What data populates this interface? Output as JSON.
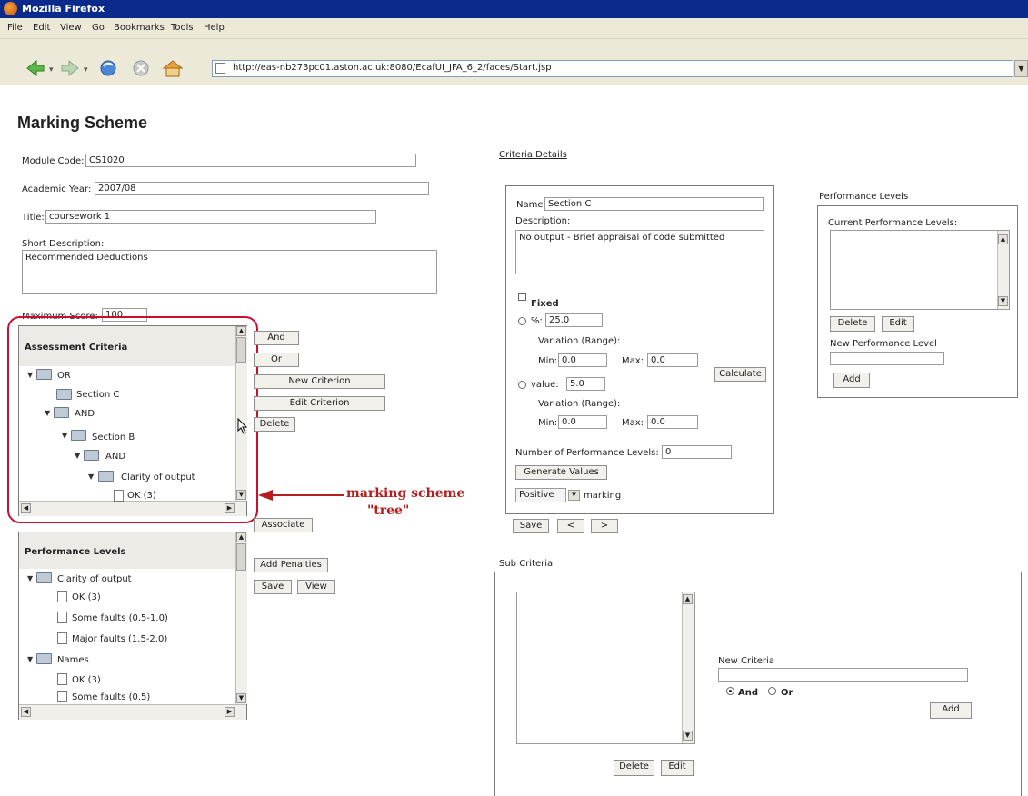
{
  "window": {
    "title": "Mozilla Firefox"
  },
  "menu": [
    "File",
    "Edit",
    "View",
    "Go",
    "Bookmarks",
    "Tools",
    "Help"
  ],
  "address": {
    "url": "http://eas-nb273pc01.aston.ac.uk:8080/EcafUI_JFA_6_2/faces/Start.jsp"
  },
  "page": {
    "title": "Marking Scheme",
    "module_code": {
      "label": "Module Code:",
      "value": "CS1020"
    },
    "academic_year": {
      "label": "Academic Year:",
      "value": "2007/08"
    },
    "title_field": {
      "label": "Title:",
      "value": "coursework 1"
    },
    "short_description": {
      "label": "Short Description:",
      "value": "Recommended Deductions"
    },
    "maximum_score": {
      "label": "Maximum Score:",
      "value": "100"
    }
  },
  "assessment_criteria": {
    "heading": "Assessment Criteria",
    "nodes": {
      "or": "OR",
      "section_c": "Section C",
      "and1": "AND",
      "section_b": "Section B",
      "and2": "AND",
      "clarity": "Clarity of output",
      "ok": "OK (3)"
    }
  },
  "criteria_buttons": {
    "and": "And",
    "or": "Or",
    "new": "New Criterion",
    "edit": "Edit Criterion",
    "delete": "Delete"
  },
  "annotation": {
    "line1": "marking scheme",
    "line2": "\"tree\""
  },
  "associate_button": "Associate",
  "performance_tree": {
    "heading": "Performance Levels",
    "nodes": {
      "clarity": "Clarity of output",
      "ok1": "OK (3)",
      "some1": "Some faults (0.5-1.0)",
      "major1": "Major faults (1.5-2.0)",
      "names": "Names",
      "ok2": "OK (3)",
      "some2": "Some faults (0.5)"
    }
  },
  "perf_buttons": {
    "add": "Add Penalties",
    "save": "Save",
    "view": "View"
  },
  "criteria_details": {
    "link": "Criteria Details",
    "name_label": "Name:",
    "name_value": "Section C",
    "desc_label": "Description:",
    "desc_value": "No output - Brief appraisal of code submitted",
    "fixed_label": "Fixed",
    "percent_label": "%:",
    "percent_value": "25.0",
    "variation_label_1": "Variation (Range):",
    "min_label_1": "Min:",
    "min_value_1": "0.0",
    "max_label_1": "Max:",
    "max_value_1": "0.0",
    "calculate": "Calculate",
    "value_label": "value:",
    "value_value": "5.0",
    "variation_label_2": "Variation (Range):",
    "min_label_2": "Min:",
    "min_value_2": "0.0",
    "max_label_2": "Max:",
    "max_value_2": "0.0",
    "num_levels_label": "Number of Performance Levels:",
    "num_levels_value": "0",
    "generate": "Generate Values",
    "marking_select": "Positive",
    "marking_label": "marking",
    "save": "Save",
    "prev": "<",
    "next": ">"
  },
  "perf_levels_panel": {
    "title": "Performance Levels",
    "current_label": "Current Performance Levels:",
    "delete": "Delete",
    "edit": "Edit",
    "new_label": "New Performance Level",
    "add": "Add"
  },
  "sub_criteria": {
    "title": "Sub Criteria",
    "new_label": "New Criteria",
    "and_label": "And",
    "or_label": "Or",
    "add": "Add",
    "delete": "Delete",
    "edit": "Edit"
  },
  "colors": {
    "titlebar": "#0a2a8c",
    "annotation": "#b41e1e",
    "chrome": "#ece9d8"
  }
}
